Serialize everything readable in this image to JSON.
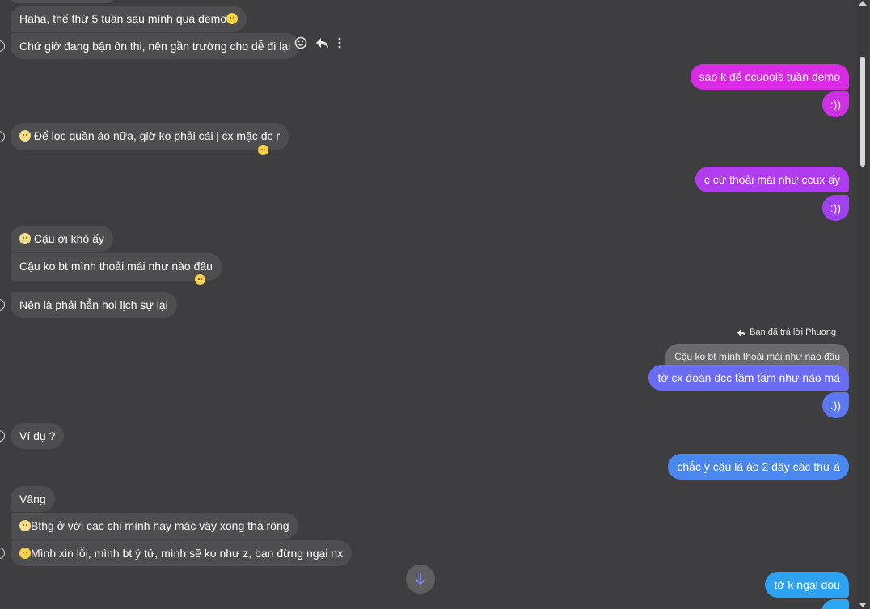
{
  "theme": {
    "background": "#3e3e40",
    "incoming_bubble": "#4e4e50",
    "quoted_bubble": "#6a6a6c",
    "outgoing_gradient": [
      "#d92be3",
      "#b13bef",
      "#8f52f5",
      "#6a6cf4",
      "#4a87ee",
      "#2ea2f0"
    ]
  },
  "icons": {
    "hover_react": "smiley-icon",
    "hover_reply": "reply-arrow-icon",
    "hover_more": "more-vertical-icon",
    "reply_label": "reply-arrow-icon",
    "scroll_down": "arrow-down-icon"
  },
  "messages": {
    "m1": {
      "text": "Haha, thế thứ 5 tuần sau mình qua demo"
    },
    "m2": {
      "text": "Chứ giờ đang bận ôn thi, nên gần trường cho dễ đi lại"
    },
    "m3": {
      "text": "sao k để ccuoois tuần demo"
    },
    "m4": {
      "text": ":))"
    },
    "m5": {
      "text": "Để lọc quần áo nữa, giờ ko phải cái j cx mặc đc r"
    },
    "m6": {
      "text": "c cứ thoải mái như ccux ấy"
    },
    "m7": {
      "text": ":))"
    },
    "m8": {
      "text": "Cậu ơi khó ấy"
    },
    "m9": {
      "text": "Cậu ko bt mình thoải mái như nào đâu"
    },
    "m10": {
      "text": "Nên là phải hẳn hoi lịch sự lại"
    },
    "reply_label": "Bạn đã trả lời Phuong",
    "m11_quoted": "Cậu ko bt mình thoải mái như nào đâu",
    "m11": {
      "text": "tớ cx đoán dcc tầm tầm như nào mà"
    },
    "m12": {
      "text": ":))"
    },
    "m13": {
      "text": "Ví dụ ?"
    },
    "m14": {
      "text": "chắc ý cậu là áo 2 dây các thứ à"
    },
    "m15": {
      "text": "Vâng"
    },
    "m16": {
      "text": "Bthg ở với các chị mình hay mặc vậy xong thả rông"
    },
    "m17": {
      "text": "Mình xin lỗi, mình bt ý tứ, mình sẽ ko như z, bạn đừng ngại nx"
    },
    "m18": {
      "text": "tớ k ngại dou"
    }
  }
}
